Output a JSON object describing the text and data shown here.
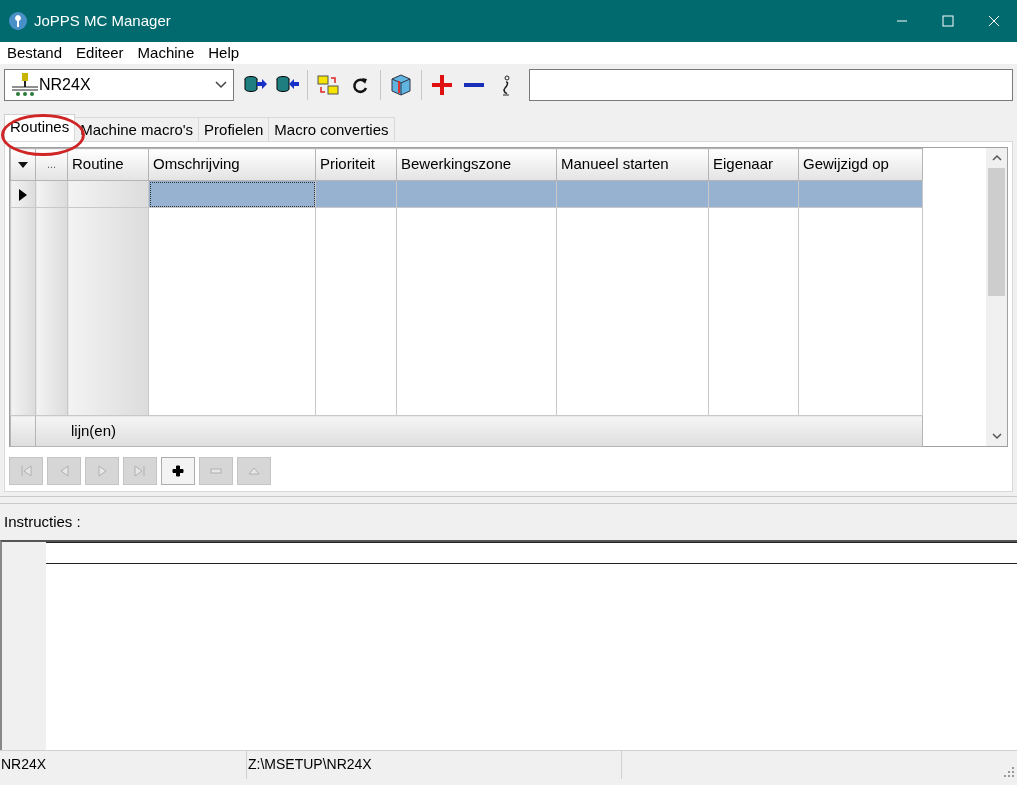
{
  "window": {
    "title": "JoPPS MC Manager"
  },
  "menu": [
    {
      "label": "Bestand"
    },
    {
      "label": "Editeer"
    },
    {
      "label": "Machine"
    },
    {
      "label": "Help"
    }
  ],
  "toolbar": {
    "machine": {
      "value": "NR24X"
    },
    "buttons": [
      {
        "kind": "export"
      },
      {
        "kind": "import"
      },
      {
        "kind": "sep"
      },
      {
        "kind": "folders"
      },
      {
        "kind": "refresh"
      },
      {
        "kind": "sep"
      },
      {
        "kind": "cube"
      },
      {
        "kind": "sep"
      },
      {
        "kind": "add"
      },
      {
        "kind": "remove"
      },
      {
        "kind": "info"
      }
    ]
  },
  "tabs": [
    {
      "label": "Routines",
      "selected": true
    },
    {
      "label": "Machine macro's",
      "selected": false
    },
    {
      "label": "Profielen",
      "selected": false
    },
    {
      "label": "Macro converties",
      "selected": false
    }
  ],
  "grid": {
    "columns": [
      {
        "label": "..."
      },
      {
        "label": "Routine"
      },
      {
        "label": "Omschrijving"
      },
      {
        "label": "Prioriteit"
      },
      {
        "label": "Bewerkingszone"
      },
      {
        "label": "Manueel starten"
      },
      {
        "label": "Eigenaar"
      },
      {
        "label": "Gewijzigd op"
      }
    ],
    "rows": [
      {
        "selected": true
      }
    ],
    "footer": "lijn(en)"
  },
  "navigator": [
    {
      "kind": "first",
      "disabled": true
    },
    {
      "kind": "prev",
      "disabled": true
    },
    {
      "kind": "next",
      "disabled": true
    },
    {
      "kind": "last",
      "disabled": true
    },
    {
      "kind": "add",
      "disabled": false
    },
    {
      "kind": "delete",
      "disabled": true
    },
    {
      "kind": "up",
      "disabled": true
    }
  ],
  "instructions": {
    "label": "Instructies :"
  },
  "status_bar": [
    "NR24X",
    "Z:\\MSETUP\\NR24X"
  ]
}
